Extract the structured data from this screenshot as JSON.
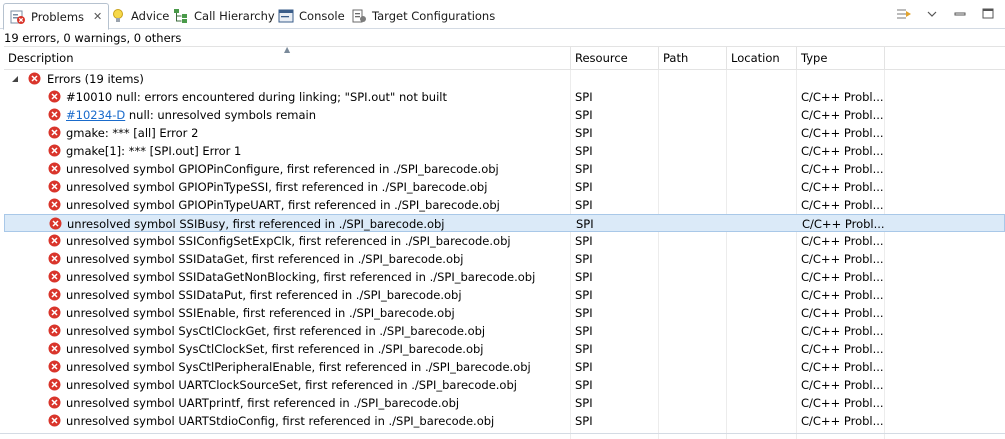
{
  "tabs": [
    {
      "label": "Problems",
      "icon": "problems-icon",
      "active": true
    },
    {
      "label": "Advice",
      "icon": "lightbulb-icon"
    },
    {
      "label": "Call Hierarchy",
      "icon": "call-hierarchy-icon"
    },
    {
      "label": "Console",
      "icon": "console-icon"
    },
    {
      "label": "Target Configurations",
      "icon": "target-config-icon"
    }
  ],
  "summary": "19 errors, 0 warnings, 0 others",
  "columns": {
    "description": "Description",
    "resource": "Resource",
    "path": "Path",
    "location": "Location",
    "type": "Type"
  },
  "group": {
    "label": "Errors (19 items)"
  },
  "errors": [
    {
      "id": "",
      "text": "#10010 null: errors encountered during linking; \"SPI.out\" not built",
      "resource": "SPI",
      "type": "C/C++ Probl..."
    },
    {
      "id": "#10234-D",
      "text": " null: unresolved symbols remain",
      "resource": "SPI",
      "type": "C/C++ Probl..."
    },
    {
      "id": "",
      "text": "gmake: *** [all] Error 2",
      "resource": "SPI",
      "type": "C/C++ Probl..."
    },
    {
      "id": "",
      "text": "gmake[1]: *** [SPI.out] Error 1",
      "resource": "SPI",
      "type": "C/C++ Probl..."
    },
    {
      "id": "",
      "text": "unresolved symbol GPIOPinConfigure, first referenced in ./SPI_barecode.obj",
      "resource": "SPI",
      "type": "C/C++ Probl..."
    },
    {
      "id": "",
      "text": "unresolved symbol GPIOPinTypeSSI, first referenced in ./SPI_barecode.obj",
      "resource": "SPI",
      "type": "C/C++ Probl..."
    },
    {
      "id": "",
      "text": "unresolved symbol GPIOPinTypeUART, first referenced in ./SPI_barecode.obj",
      "resource": "SPI",
      "type": "C/C++ Probl..."
    },
    {
      "id": "",
      "text": "unresolved symbol SSIBusy, first referenced in ./SPI_barecode.obj",
      "resource": "SPI",
      "type": "C/C++ Probl...",
      "selected": true
    },
    {
      "id": "",
      "text": "unresolved symbol SSIConfigSetExpClk, first referenced in ./SPI_barecode.obj",
      "resource": "SPI",
      "type": "C/C++ Probl..."
    },
    {
      "id": "",
      "text": "unresolved symbol SSIDataGet, first referenced in ./SPI_barecode.obj",
      "resource": "SPI",
      "type": "C/C++ Probl..."
    },
    {
      "id": "",
      "text": "unresolved symbol SSIDataGetNonBlocking, first referenced in ./SPI_barecode.obj",
      "resource": "SPI",
      "type": "C/C++ Probl..."
    },
    {
      "id": "",
      "text": "unresolved symbol SSIDataPut, first referenced in ./SPI_barecode.obj",
      "resource": "SPI",
      "type": "C/C++ Probl..."
    },
    {
      "id": "",
      "text": "unresolved symbol SSIEnable, first referenced in ./SPI_barecode.obj",
      "resource": "SPI",
      "type": "C/C++ Probl..."
    },
    {
      "id": "",
      "text": "unresolved symbol SysCtlClockGet, first referenced in ./SPI_barecode.obj",
      "resource": "SPI",
      "type": "C/C++ Probl..."
    },
    {
      "id": "",
      "text": "unresolved symbol SysCtlClockSet, first referenced in ./SPI_barecode.obj",
      "resource": "SPI",
      "type": "C/C++ Probl..."
    },
    {
      "id": "",
      "text": "unresolved symbol SysCtlPeripheralEnable, first referenced in ./SPI_barecode.obj",
      "resource": "SPI",
      "type": "C/C++ Probl..."
    },
    {
      "id": "",
      "text": "unresolved symbol UARTClockSourceSet, first referenced in ./SPI_barecode.obj",
      "resource": "SPI",
      "type": "C/C++ Probl..."
    },
    {
      "id": "",
      "text": "unresolved symbol UARTprintf, first referenced in ./SPI_barecode.obj",
      "resource": "SPI",
      "type": "C/C++ Probl..."
    },
    {
      "id": "",
      "text": "unresolved symbol UARTStdioConfig, first referenced in ./SPI_barecode.obj",
      "resource": "SPI",
      "type": "C/C++ Probl..."
    }
  ],
  "colors": {
    "error": "#d9352b",
    "selection": "#dbeaf8",
    "link": "#1a6bcb"
  }
}
